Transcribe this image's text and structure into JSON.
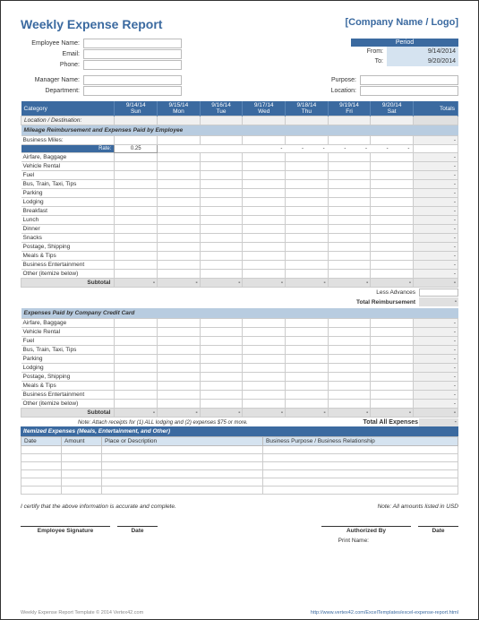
{
  "title": "Weekly Expense Report",
  "company_name": "[Company Name / Logo]",
  "info_left_1": [
    {
      "label": "Employee Name:"
    },
    {
      "label": "Email:"
    },
    {
      "label": "Phone:"
    }
  ],
  "info_left_2": [
    {
      "label": "Manager Name:"
    },
    {
      "label": "Department:"
    }
  ],
  "info_right_2": [
    {
      "label": "Purpose:"
    },
    {
      "label": "Location:"
    }
  ],
  "period": {
    "header": "Period",
    "from_label": "From:",
    "from_value": "9/14/2014",
    "to_label": "To:",
    "to_value": "9/20/2014"
  },
  "table": {
    "category_label": "Category",
    "totals_label": "Totals",
    "days": [
      {
        "date": "9/14/14",
        "dow": "Sun"
      },
      {
        "date": "9/15/14",
        "dow": "Mon"
      },
      {
        "date": "9/16/14",
        "dow": "Tue"
      },
      {
        "date": "9/17/14",
        "dow": "Wed"
      },
      {
        "date": "9/18/14",
        "dow": "Thu"
      },
      {
        "date": "9/19/14",
        "dow": "Fri"
      },
      {
        "date": "9/20/14",
        "dow": "Sat"
      }
    ],
    "location_row": "Location / Destination:",
    "section1_title": "Mileage Reimbursement and Expenses Paid by Employee",
    "business_miles": "Business Miles:",
    "rate_label": "Rate:",
    "rate_value": "0.25",
    "rows1": [
      "Airfare, Baggage",
      "Vehicle Rental",
      "Fuel",
      "Bus, Train, Taxi, Tips",
      "Parking",
      "Lodging",
      "Breakfast",
      "Lunch",
      "Dinner",
      "Snacks",
      "Postage, Shipping",
      "Meals & Tips",
      "Business Entertainment",
      "Other (itemize below)"
    ],
    "subtotal_label": "Subtotal",
    "less_advances": "Less Advances",
    "total_reimb": "Total Reimbursement",
    "section2_title": "Expenses Paid by Company Credit Card",
    "rows2": [
      "Airfare, Baggage",
      "Vehicle Rental",
      "Fuel",
      "Bus, Train, Taxi, Tips",
      "Parking",
      "Lodging",
      "Postage, Shipping",
      "Meals & Tips",
      "Business Entertainment",
      "Other (itemize below)"
    ],
    "note": "Note: Attach receipts for (1) ALL lodging and (2) expenses $75 or more.",
    "total_all": "Total All Expenses"
  },
  "itemized": {
    "title": "Itemized Expenses (Meals, Entertainment, and Other)",
    "cols": [
      "Date",
      "Amount",
      "Place or Description",
      "Business Purpose / Business Relationship"
    ]
  },
  "certify": "I certify that the above information is accurate and complete.",
  "currency_note": "Note: All amounts listed in USD",
  "sigs": {
    "emp": "Employee Signature",
    "date": "Date",
    "auth": "Authorized By",
    "print": "Print Name:"
  },
  "footer": {
    "left": "Weekly Expense Report Template © 2014 Vertex42.com",
    "right": "http://www.vertex42.com/ExcelTemplates/excel-expense-report.html"
  }
}
